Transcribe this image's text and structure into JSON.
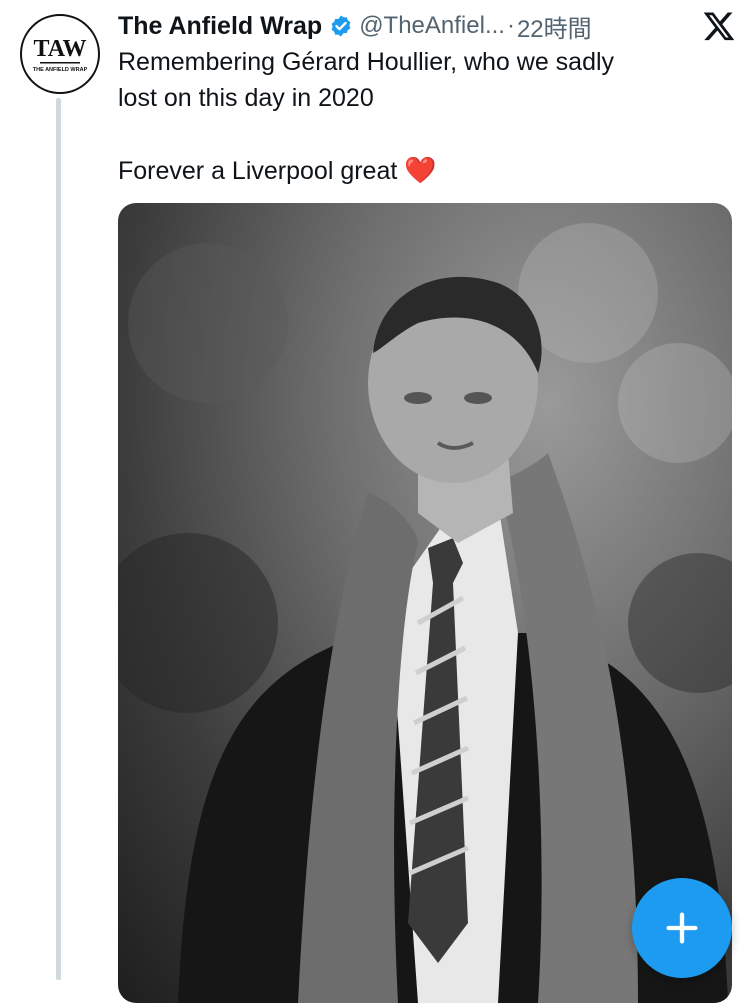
{
  "tweet": {
    "display_name": "The Anfield Wrap",
    "handle": "@TheAnfiel...",
    "separator": "·",
    "timestamp": "22時間",
    "line1": "Remembering Gérard Houllier, who we sadly",
    "line2": "lost on this day in 2020",
    "line3": "Forever a Liverpool great",
    "emoji": "❤️",
    "avatar_text": "TAW",
    "avatar_subtext": "THE ANFIELD WRAP"
  },
  "colors": {
    "accent": "#1d9bf0",
    "thread_line": "#cfd9de",
    "secondary_text": "#536471"
  },
  "icons": {
    "verified": "verified-badge-icon",
    "platform": "x-logo-icon",
    "compose": "plus-icon"
  }
}
